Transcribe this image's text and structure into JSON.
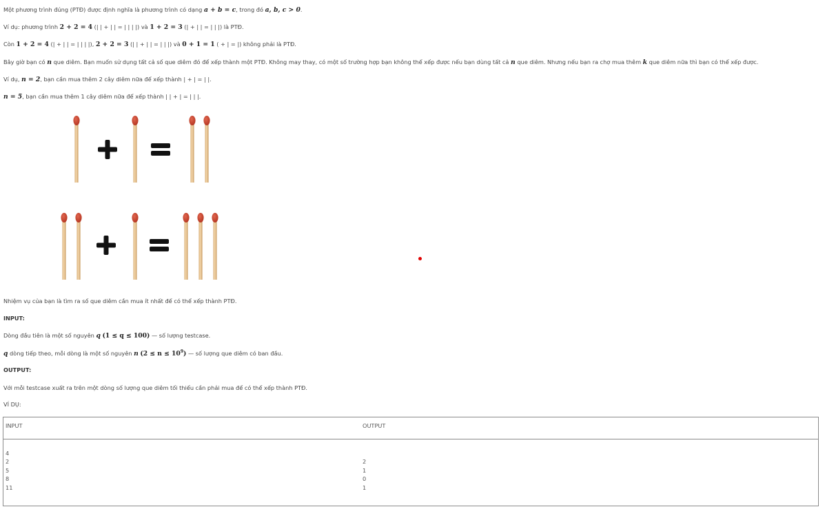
{
  "statement": {
    "line1": {
      "text_a": "Một phương trình đúng (PTĐ) được định nghĩa là phương trình có dạng",
      "math_a": "a + b = c",
      "text_b": ", trong đó",
      "math_b": "a, b, c > 0",
      "text_c": "."
    },
    "line2": {
      "text_a": "Ví dụ: phương trình",
      "math_a": "2 + 2 = 4",
      "text_b": "(| | + | | = | | | |) và",
      "math_b": "1 + 2 = 3",
      "text_c": "(| + | | = | | |) là PTĐ."
    },
    "line3": {
      "text_a": "Còn",
      "math_a": "1 + 2 = 4",
      "text_b": "(| + | | = | | | |),",
      "math_b": "2 + 2 = 3",
      "text_c": "(| | + | | = | | |) và",
      "math_c": "0 + 1 = 1",
      "text_d": "( + | = |) không phải là PTĐ."
    },
    "line4": {
      "text_a": "Bây giờ bạn có",
      "math_a": "n",
      "text_b": "que diêm. Bạn muốn sử dụng tất cả số que diêm đó để xếp thành một PTĐ. Không may thay, có một số trường hợp bạn không thể xếp được nếu bạn dùng tất cả",
      "math_b": "n",
      "text_c": "que diêm. Nhưng nếu bạn ra chợ mua thêm",
      "math_c": "k",
      "text_d": "que diêm nữa thì bạn có thể xếp được."
    },
    "line5": {
      "text_a": "Ví dụ,",
      "math_a": "n = 2",
      "text_b": ", bạn cần mua thêm 2 cây diêm nữa để xếp thành | + | = | |."
    },
    "line6": {
      "math_a": "n = 5",
      "text_b": ", bạn cần mua thêm 1 cây diêm nữa để xếp thành | | + | = | | |."
    }
  },
  "figure": {
    "plus_symbol": "+",
    "equals_symbol": "=",
    "row1": {
      "left_count": 1,
      "middle_count": 1,
      "right_count": 2
    },
    "row2": {
      "left_count": 2,
      "middle_count": 1,
      "right_count": 3
    },
    "colors": {
      "stick": "#ecc996",
      "stick_edge": "#c9a06a",
      "head": "#c9412c",
      "symbol": "#111111"
    }
  },
  "task": "Nhiệm vụ của bạn là tìm ra số que diêm cần mua ít nhất để có thể xếp thành PTĐ.",
  "input_section": {
    "title": "INPUT:",
    "line1": {
      "text_a": "Dòng đầu tiên là một số nguyên",
      "math_a": "q",
      "math_b": "(1 ≤ q ≤ 100)",
      "text_b": "— số lượng testcase."
    },
    "line2": {
      "math_a": "q",
      "text_a": "dòng tiếp theo, mỗi dòng là một số nguyên",
      "math_b": "n",
      "math_c_pre": "(2 ≤ n ≤ 10",
      "math_c_sup": "9",
      "math_c_post": ")",
      "text_b": "— số lượng que diêm có ban đầu."
    }
  },
  "output_section": {
    "title": "OUTPUT:",
    "line1": "Với mỗi testcase xuất ra trên một dòng số lượng que diêm tối thiểu cần phải mua để có thể xếp thành PTĐ."
  },
  "example_label": "VÍ DỤ:",
  "sample": {
    "input_header": "INPUT",
    "output_header": "OUTPUT",
    "input_lines": [
      "4",
      "2",
      "5",
      "8",
      "11"
    ],
    "output_lines": [
      "2",
      "1",
      "0",
      "1"
    ]
  }
}
